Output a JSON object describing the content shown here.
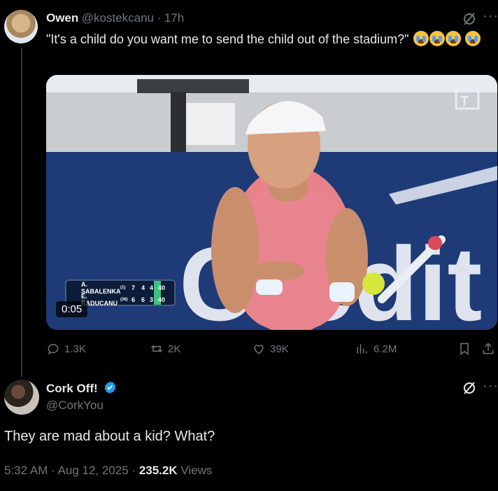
{
  "tweet1": {
    "author_name": "Owen",
    "handle": "@kostekcanu",
    "time": "· 17h",
    "text": "\"It's a child do you want me to send the child out of the stadium?\"",
    "video_duration": "0:05",
    "scoreboard": [
      {
        "player": "A. SABALENKA",
        "seed": "(1)",
        "s1": "7",
        "s2": "4",
        "s3": "4",
        "pts": "40"
      },
      {
        "player": "E. RADUCANU",
        "seed": "(36)",
        "s1": "6",
        "s2": "6",
        "s3": "3",
        "pts": "40"
      }
    ],
    "stats": {
      "replies": "1.3K",
      "reposts": "2K",
      "likes": "39K",
      "views": "6.2M"
    }
  },
  "tweet2": {
    "author_name": "Cork Off!",
    "handle": "@CorkYou",
    "text": "They are mad about a kid? What?",
    "timestamp": "5:32 AM · Aug 12, 2025 ·",
    "views_count": "235.2K",
    "views_label": "Views"
  },
  "colors": {
    "background": "#000000",
    "text": "#e7e9ea",
    "muted": "#71767b",
    "verified": "#1d9bf0"
  }
}
